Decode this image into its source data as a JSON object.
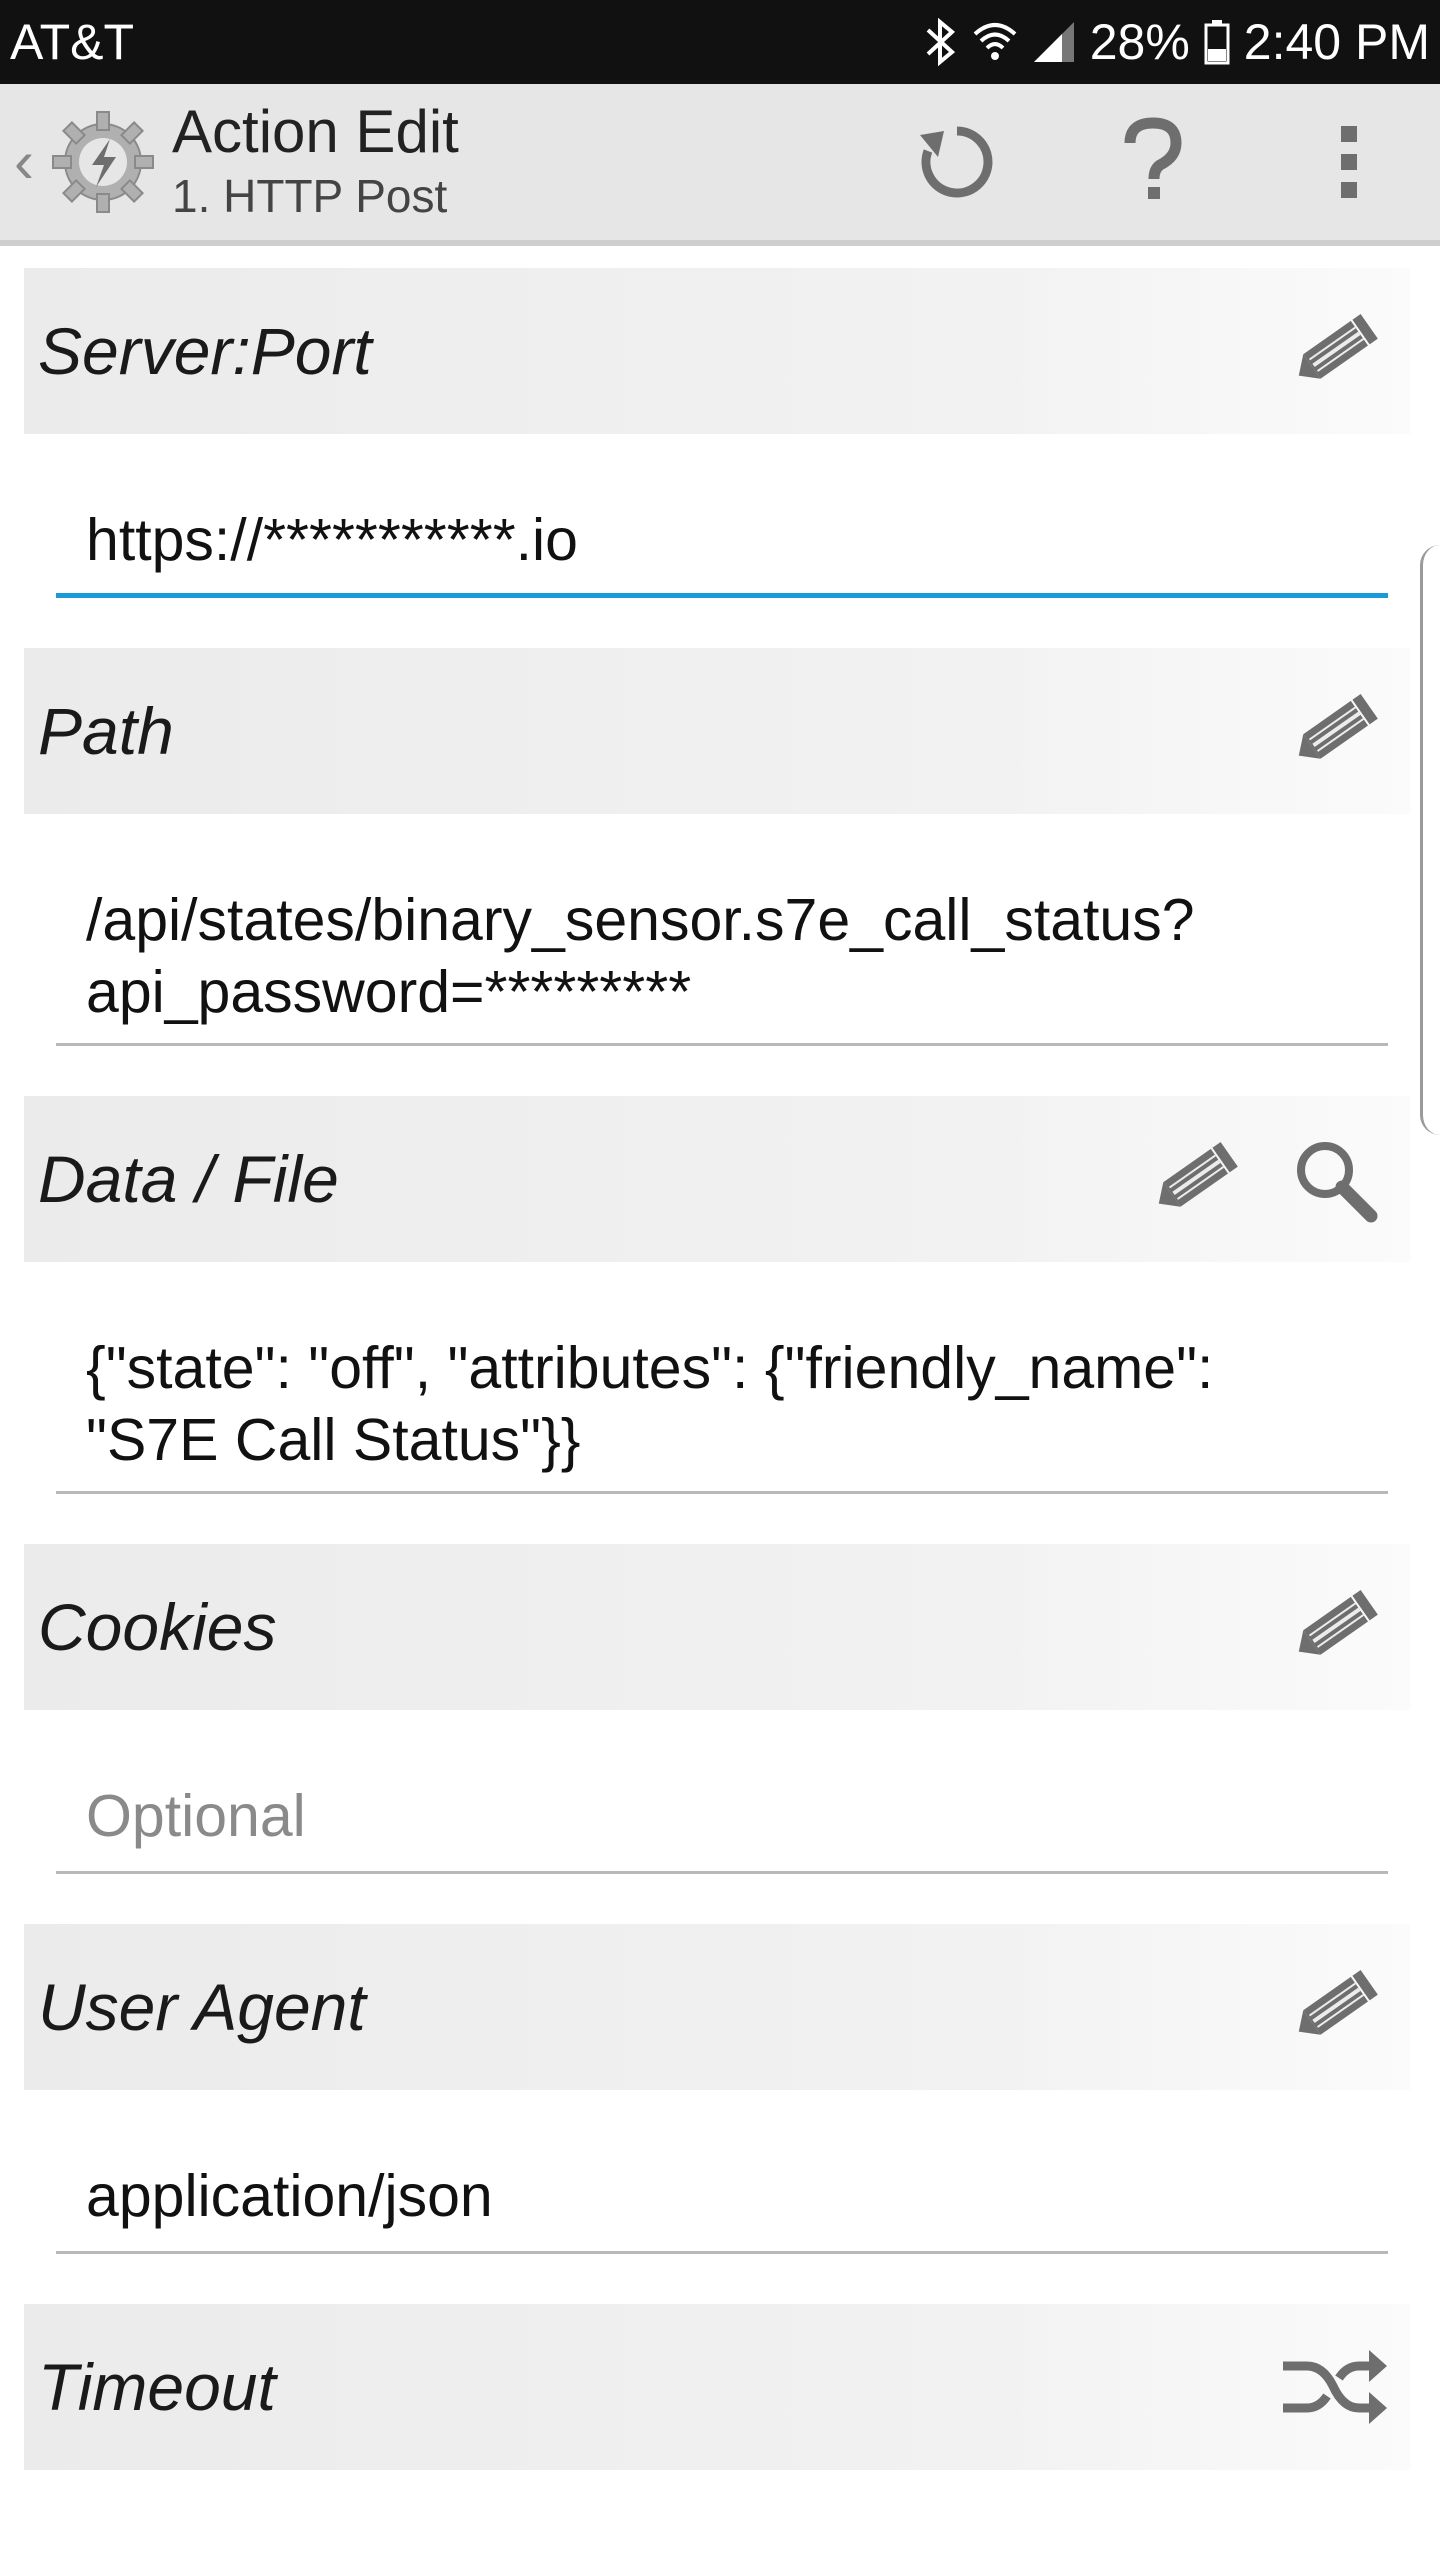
{
  "status_bar": {
    "carrier": "AT&T",
    "battery": "28%",
    "time": "2:40 PM",
    "icons": [
      "bluetooth-icon",
      "wifi-icon",
      "signal-icon",
      "battery-icon"
    ]
  },
  "action_bar": {
    "title": "Action Edit",
    "subtitle": "1. HTTP Post",
    "icons": [
      "back-chevron-icon",
      "app-logo-icon",
      "reset-icon",
      "help-icon",
      "overflow-menu-icon"
    ]
  },
  "sections": {
    "server_port": {
      "label": "Server:Port",
      "value": "https://***********.io",
      "icon": "pencil-icon"
    },
    "path": {
      "label": "Path",
      "value": "/api/states/binary_sensor.s7e_call_status?\napi_password=*********",
      "icon": "pencil-icon"
    },
    "data_file": {
      "label": "Data / File",
      "value": "{\"state\": \"off\", \"attributes\": {\"friendly_name\":\n\"S7E Call Status\"}}",
      "icons": [
        "pencil-icon",
        "search-icon"
      ]
    },
    "cookies": {
      "label": "Cookies",
      "placeholder": "Optional",
      "icon": "pencil-icon"
    },
    "user_agent": {
      "label": "User Agent",
      "value": "application/json",
      "icon": "pencil-icon"
    },
    "timeout": {
      "label": "Timeout",
      "icon": "shuffle-icon"
    }
  },
  "colors": {
    "status_bar_bg": "#111111",
    "action_bar_bg": "#e6e6e6",
    "active_underline": "#1a9ad6",
    "icon_gray": "#6e6e6e"
  }
}
